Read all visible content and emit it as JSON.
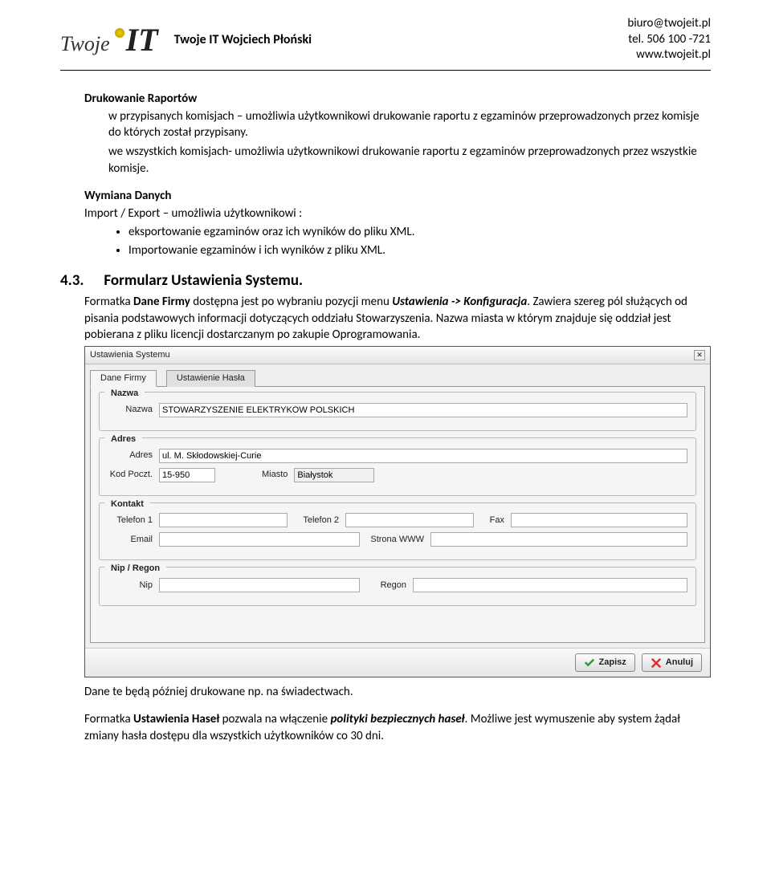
{
  "header": {
    "logo_twoje": "Twoje",
    "company_line": "Twoje IT Wojciech Płoński",
    "contact": {
      "email": "biuro@twojeit.pl",
      "phone": "tel. 506 100 -721",
      "web": "www.twojeit.pl"
    }
  },
  "section_reports": {
    "title": "Drukowanie Raportów",
    "line1_prefix": "w przypisanych komisjach",
    "line1_rest": " – umożliwia użytkownikowi drukowanie raportu z egzaminów przeprowadzonych przez komisje do których został przypisany.",
    "line2_prefix": "we wszystkich komisjach",
    "line2_rest": "- umożliwia użytkownikowi drukowanie raportu z egzaminów przeprowadzonych przez wszystkie komisje."
  },
  "section_exchange": {
    "title": "Wymiana Danych",
    "intro": "Import / Export – umożliwia użytkownikowi :",
    "bullets": [
      "eksportowanie egzaminów oraz ich wyników do pliku XML.",
      "Importowanie egzaminów i ich wyników z pliku XML."
    ]
  },
  "h43": {
    "num": "4.3.",
    "title": "Formularz Ustawienia Systemu."
  },
  "para43": {
    "t1": "Formatka ",
    "b1": "Dane Firmy",
    "t2": "  dostępna jest po wybraniu pozycji menu ",
    "bi1": "Ustawienia -> Konfiguracja",
    "t3": ". Zawiera szereg pól służących od pisania podstawowych informacji dotyczących oddziału Stowarzyszenia. Nazwa miasta w którym znajduje się oddział jest pobierana z pliku licencji dostarczanym po zakupie Oprogramowania."
  },
  "dialog": {
    "title": "Ustawienia Systemu",
    "tabs": {
      "active": "Dane  Firmy",
      "t2": "Ustawienie Hasła"
    },
    "grp_name": {
      "title": "Nazwa",
      "label": "Nazwa",
      "value": "STOWARZYSZENIE ELEKTRYKÓW POLSKICH"
    },
    "grp_addr": {
      "title": "Adres",
      "addr_label": "Adres",
      "addr_value": "ul. M. Skłodowskiej-Curie",
      "zip_label": "Kod Poczt.",
      "zip_value": "15-950",
      "city_label": "Miasto",
      "city_value": "Białystok"
    },
    "grp_contact": {
      "title": "Kontakt",
      "tel1": "Telefon 1",
      "tel2": "Telefon 2",
      "fax": "Fax",
      "email": "Email",
      "www": "Strona WWW"
    },
    "grp_nip": {
      "title": "Nip / Regon",
      "nip": "Nip",
      "regon": "Regon"
    },
    "btn_save": "Zapisz",
    "btn_cancel": "Anuluj"
  },
  "after1": "Dane te będą później drukowane np. na świadectwach.",
  "after2": {
    "t1": "Formatka ",
    "b1": "Ustawienia Haseł",
    "t2": " pozwala na włączenie ",
    "bi1": "polityki bezpiecznych haseł",
    "t3": ". Możliwe jest wymuszenie aby system żądał zmiany hasła dostępu dla wszystkich użytkowników co 30 dni."
  }
}
